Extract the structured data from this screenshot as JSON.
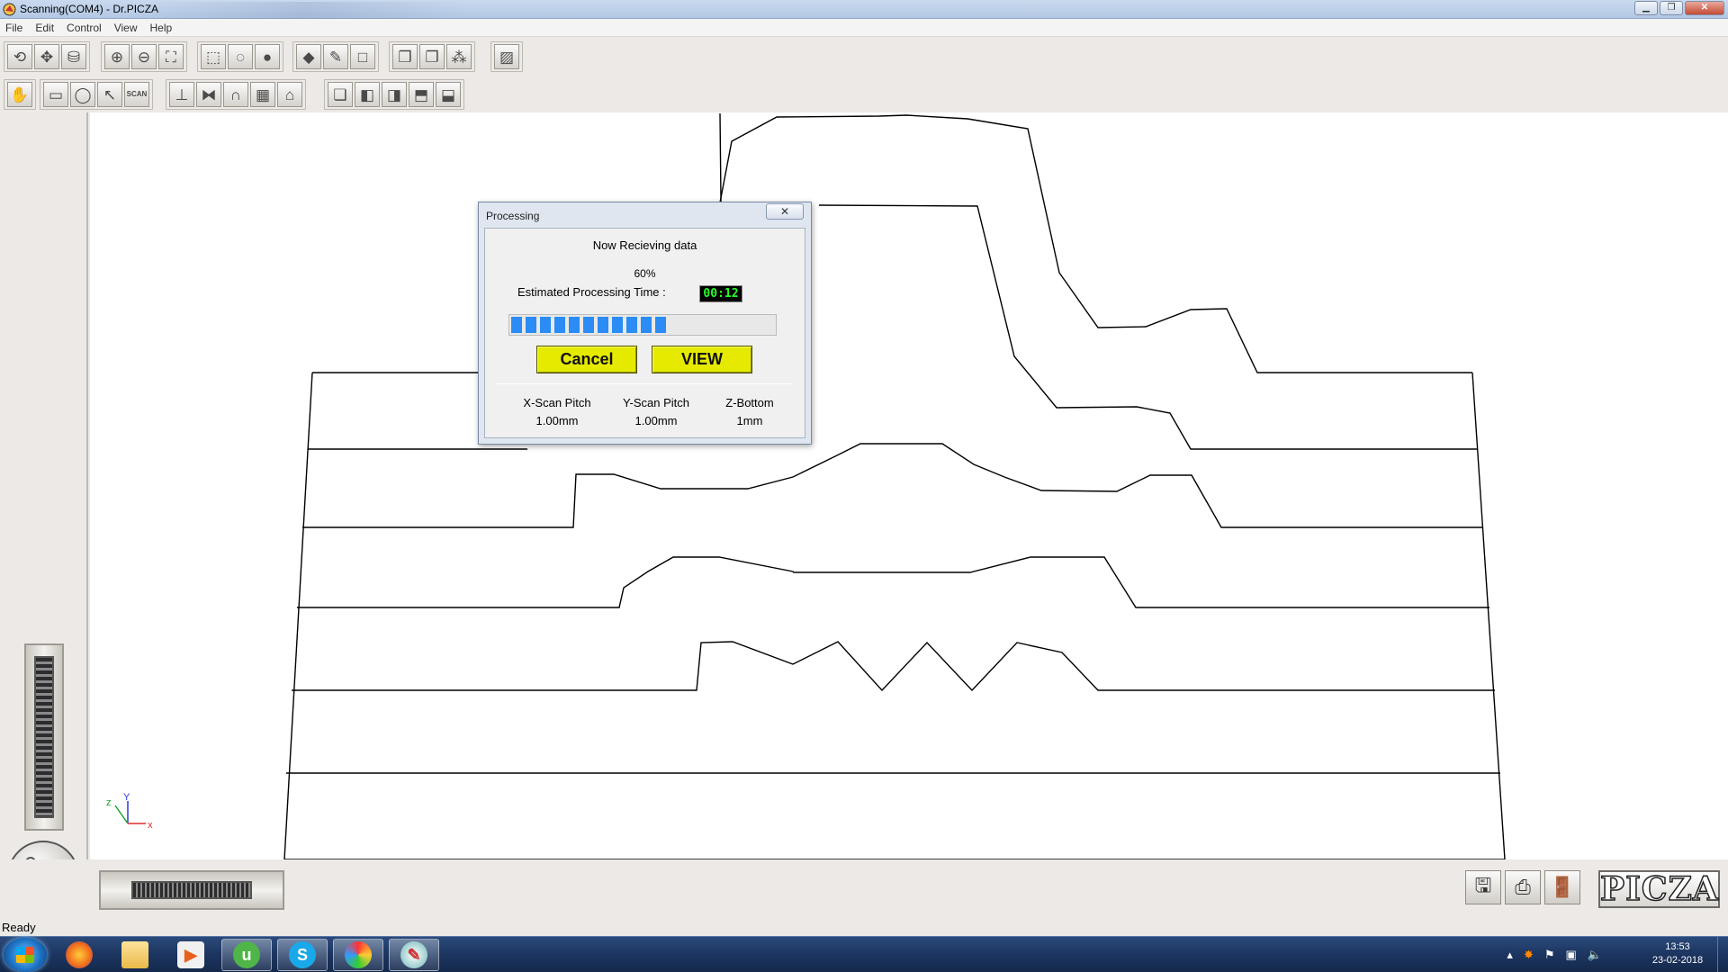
{
  "window": {
    "title": "Scanning(COM4) - Dr.PICZA"
  },
  "menu": [
    "File",
    "Edit",
    "Control",
    "View",
    "Help"
  ],
  "toolbar1": {
    "groups": [
      [
        "rotate-icon",
        "move-icon",
        "cylinder-icon"
      ],
      [
        "zoom-in-icon",
        "zoom-out-icon",
        "fit-icon"
      ],
      [
        "wireframe-box-icon",
        "wireframe-sphere-icon",
        "solid-sphere-icon"
      ],
      [
        "paint-bucket-icon",
        "brush-icon",
        "blank-frame-icon"
      ],
      [
        "cube-stack-icon",
        "copy-icon",
        "dot-grid-icon"
      ],
      [
        "ruler-icon"
      ]
    ]
  },
  "toolbar2": {
    "groups": [
      [
        "hand-icon"
      ],
      [
        "select-rect-icon",
        "select-lasso-icon",
        "select-arrow-icon",
        "scan-icon"
      ],
      [
        "trim-icon",
        "mirror-icon",
        "arch-icon",
        "grid-icon",
        "frame-icon"
      ],
      [
        "view-front-icon",
        "view-side-icon",
        "view-back-icon",
        "view-top-icon",
        "view-iso-icon"
      ]
    ],
    "scan_label": "SCAN"
  },
  "axis": {
    "x": "x",
    "y": "Y",
    "z": "z"
  },
  "dialog": {
    "title": "Processing",
    "close_label": "✕",
    "status": "Now Recieving data",
    "percent_text": "60%",
    "progress": 0.6,
    "time_label": "Estimated Processing Time :",
    "time_value": "00:12",
    "cancel_label": "Cancel",
    "view_label": "VIEW",
    "params": [
      {
        "label": "X-Scan Pitch",
        "value": "1.00mm"
      },
      {
        "label": "Y-Scan Pitch",
        "value": "1.00mm"
      },
      {
        "label": "Z-Bottom",
        "value": "1mm"
      }
    ]
  },
  "logo": "PICZA",
  "status_text": "Ready",
  "taskbar": {
    "apps": [
      "firefox",
      "file-explorer",
      "media-player",
      "utorrent",
      "skype",
      "drpicza",
      "paint"
    ],
    "clock_time": "13:53",
    "clock_date": "23-02-2018"
  },
  "colors": {
    "button_yellow": "#e6ea00",
    "progress_blue": "#2a8cf4",
    "timer_green": "#29ff29"
  }
}
